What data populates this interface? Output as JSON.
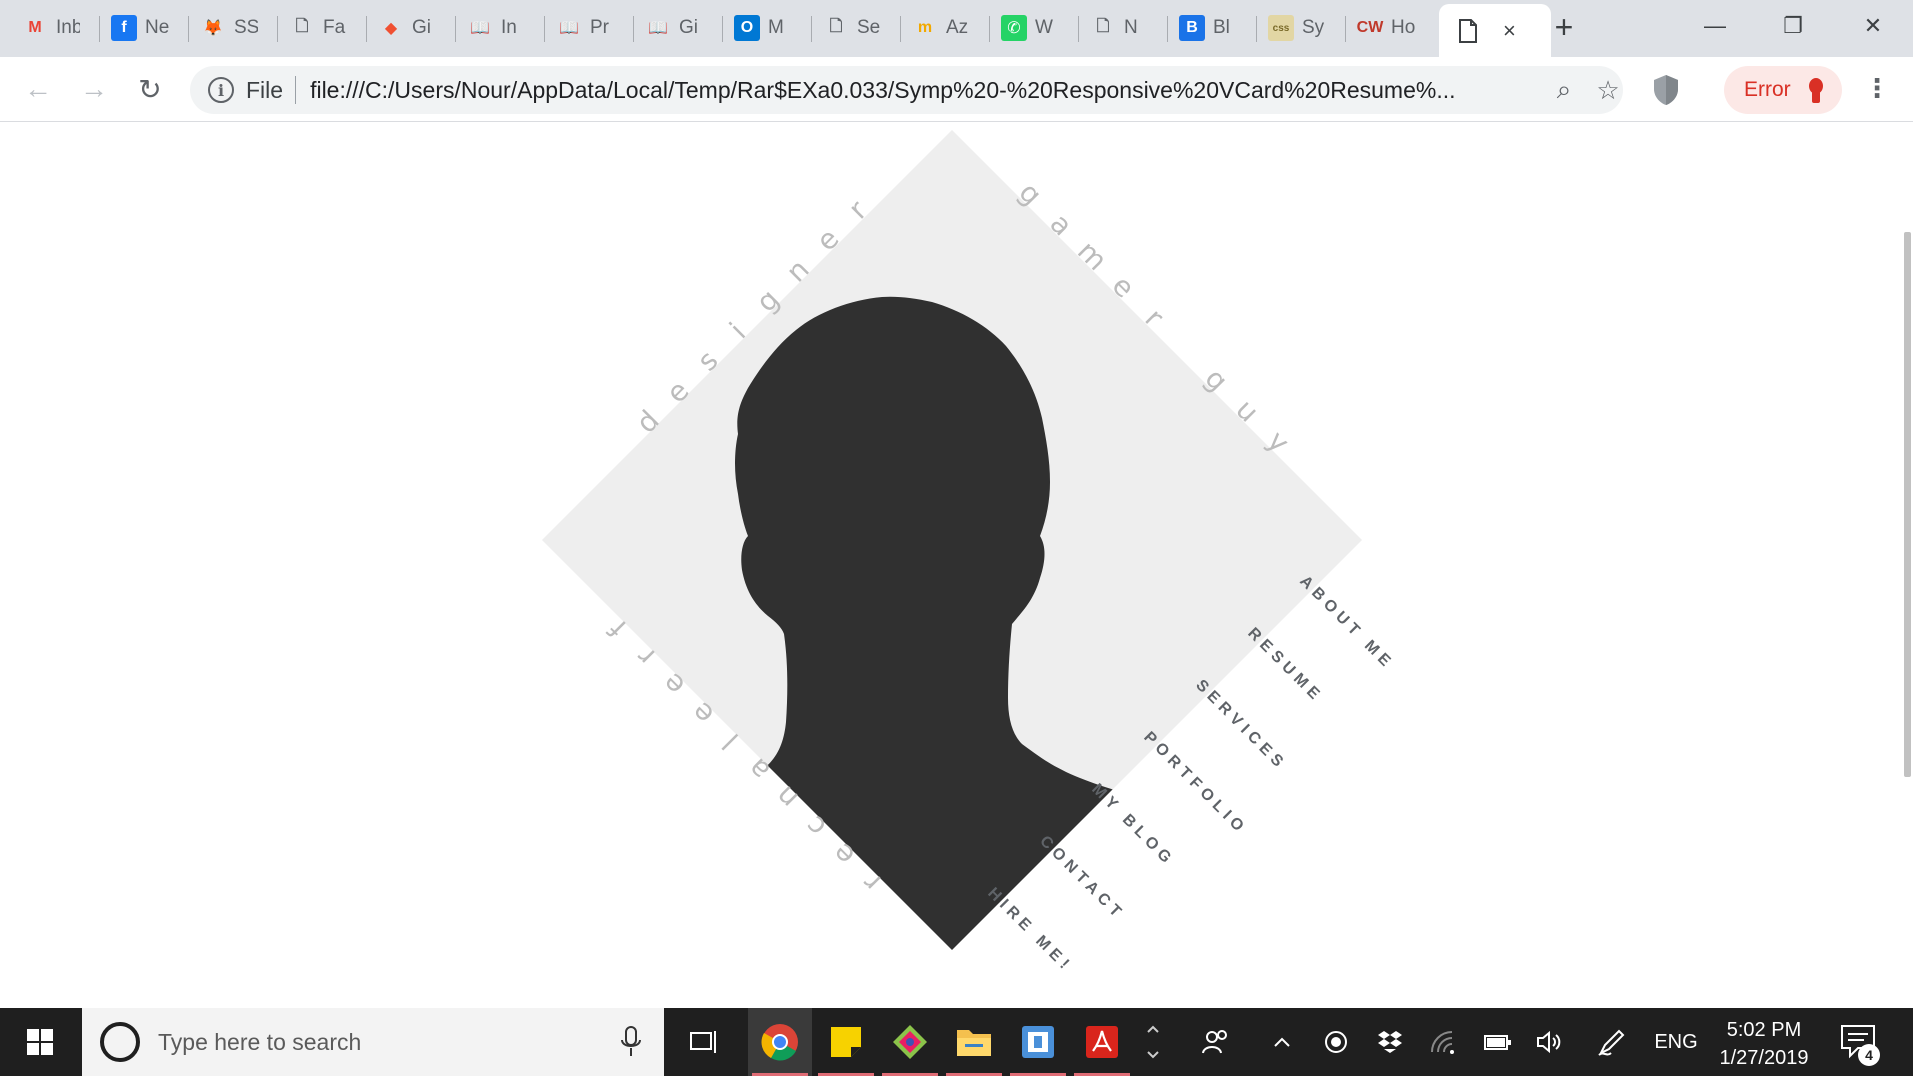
{
  "browser": {
    "tabs": [
      {
        "title": "Inbox",
        "icon": "gmail-icon",
        "glyph": "M",
        "color": "#ea4335",
        "bg": "transparent"
      },
      {
        "title": "News",
        "icon": "facebook-icon",
        "glyph": "f",
        "color": "#ffffff",
        "bg": "#1877f2"
      },
      {
        "title": "SS",
        "icon": "gitlab-icon",
        "glyph": "🦊",
        "color": "#fc6d26",
        "bg": "transparent"
      },
      {
        "title": "Fa",
        "icon": "document-icon",
        "glyph": "🗋",
        "color": "#5f6368",
        "bg": "transparent"
      },
      {
        "title": "Gi",
        "icon": "git-icon",
        "glyph": "◆",
        "color": "#f05032",
        "bg": "transparent"
      },
      {
        "title": "In",
        "icon": "book-icon",
        "glyph": "📖",
        "color": "#3c4043",
        "bg": "transparent"
      },
      {
        "title": "Pr",
        "icon": "book-icon",
        "glyph": "📖",
        "color": "#3c4043",
        "bg": "transparent"
      },
      {
        "title": "Gi",
        "icon": "book-icon",
        "glyph": "📖",
        "color": "#3c4043",
        "bg": "transparent"
      },
      {
        "title": "M",
        "icon": "outlook-icon",
        "glyph": "O",
        "color": "#ffffff",
        "bg": "#0078d4"
      },
      {
        "title": "Se",
        "icon": "document-icon",
        "glyph": "🗋",
        "color": "#5f6368",
        "bg": "transparent"
      },
      {
        "title": "Az",
        "icon": "azure-icon",
        "glyph": "m",
        "color": "#f2a900",
        "bg": "transparent"
      },
      {
        "title": "W",
        "icon": "whatsapp-icon",
        "glyph": "✆",
        "color": "#ffffff",
        "bg": "#25d366"
      },
      {
        "title": "N",
        "icon": "document-icon",
        "glyph": "🗋",
        "color": "#5f6368",
        "bg": "transparent"
      },
      {
        "title": "Bl",
        "icon": "blog-icon",
        "glyph": "B",
        "color": "#ffffff",
        "bg": "#1a73e8"
      },
      {
        "title": "Sy",
        "icon": "css-icon",
        "glyph": "css",
        "color": "#7a6a2a",
        "bg": "#e2d6a4"
      },
      {
        "title": "Ho",
        "icon": "codewars-icon",
        "glyph": "CW",
        "color": "#c0392b",
        "bg": "transparent"
      }
    ],
    "active_tab": {
      "title": "",
      "icon": "document-icon",
      "close_label": "×"
    },
    "new_tab_label": "+",
    "window_controls": {
      "minimize": "—",
      "restore": "❐",
      "close": "✕"
    },
    "nav": {
      "back": "←",
      "forward": "→",
      "reload": "↻"
    },
    "omnibox": {
      "info": "i",
      "scheme": "File",
      "url": "file:///C:/Users/Nour/AppData/Local/Temp/Rar$EXa0.033/Symp%20-%20Responsive%20VCard%20Resume%...",
      "zoom_icon": "⌕",
      "star_icon": "☆"
    },
    "error_chip": "Error",
    "menu_icon": "⋮"
  },
  "page": {
    "arc_top_left": "designer",
    "arc_top_right": "gamer guy",
    "arc_bottom_left": "freelancer",
    "menu": [
      "ABOUT ME",
      "RESUME",
      "SERVICES",
      "PORTFOLIO",
      "MY BLOG",
      "CONTACT",
      "HIRE ME!"
    ],
    "colors": {
      "diamond": "#eeeeee",
      "silhouette": "#303030",
      "menu_text": "#5f6368",
      "arc_text": "#bcbcbc"
    }
  },
  "taskbar": {
    "search_placeholder": "Type here to search",
    "apps": [
      {
        "name": "task-view-icon",
        "glyph": "⧉",
        "running": false,
        "active": false
      },
      {
        "name": "chrome-icon",
        "glyph": "",
        "running": true,
        "active": true
      },
      {
        "name": "sticky-notes-icon",
        "glyph": "",
        "running": true,
        "active": false
      },
      {
        "name": "git-kraken-icon",
        "glyph": "",
        "running": true,
        "active": false
      },
      {
        "name": "file-explorer-icon",
        "glyph": "",
        "running": true,
        "active": false
      },
      {
        "name": "app-icon",
        "glyph": "",
        "running": true,
        "active": false
      },
      {
        "name": "acrobat-icon",
        "glyph": "",
        "running": true,
        "active": false
      }
    ],
    "tray": {
      "language": "ENG",
      "time": "5:02 PM",
      "date": "1/27/2019",
      "notification_count": "4"
    }
  }
}
